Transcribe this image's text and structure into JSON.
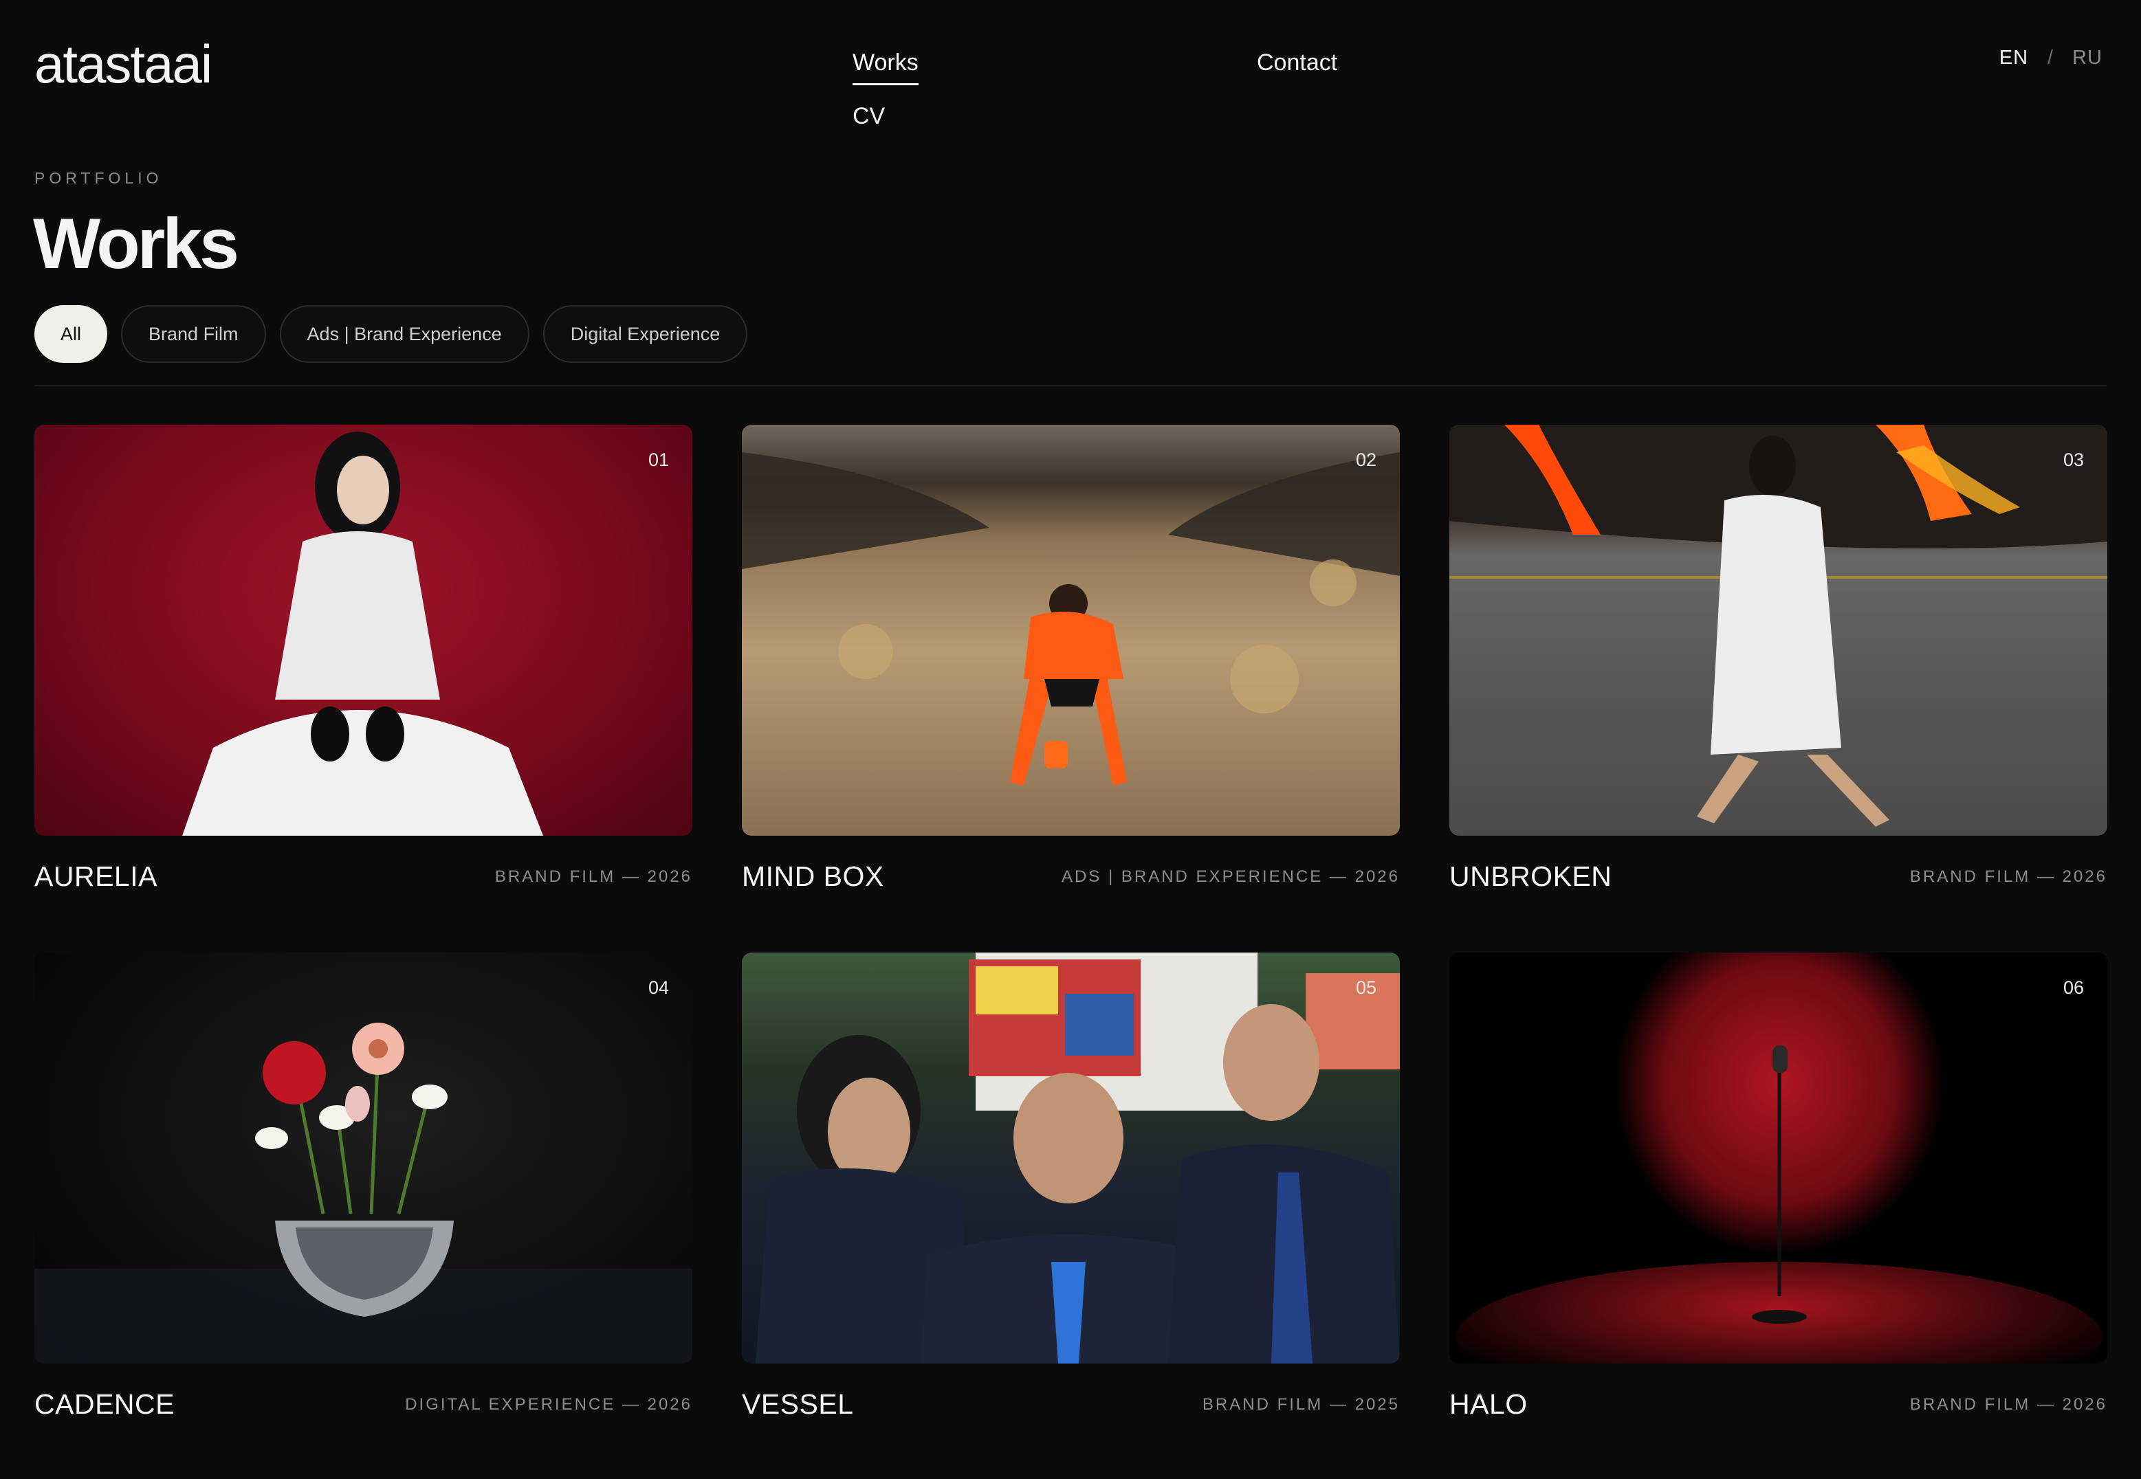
{
  "brand": {
    "logo": "atastaai"
  },
  "nav": {
    "works": "Works",
    "contact": "Contact",
    "cv": "CV"
  },
  "lang": {
    "en": "EN",
    "separator": "/",
    "ru": "RU"
  },
  "hero": {
    "eyebrow": "PORTFOLIO",
    "title": "Works"
  },
  "filters": [
    "All",
    "Brand Film",
    "Ads | Brand Experience",
    "Digital Experience"
  ],
  "works": [
    {
      "num": "01",
      "title": "AURELIA",
      "tag": "BRAND FILM — 2026"
    },
    {
      "num": "02",
      "title": "MIND BOX",
      "tag": "ADS | BRAND EXPERIENCE — 2026"
    },
    {
      "num": "03",
      "title": "UNBROKEN",
      "tag": "BRAND FILM — 2026"
    },
    {
      "num": "04",
      "title": "CADENCE",
      "tag": "DIGITAL EXPERIENCE — 2026"
    },
    {
      "num": "05",
      "title": "VESSEL",
      "tag": "BRAND FILM — 2025"
    },
    {
      "num": "06",
      "title": "HALO",
      "tag": "BRAND FILM — 2026"
    }
  ]
}
